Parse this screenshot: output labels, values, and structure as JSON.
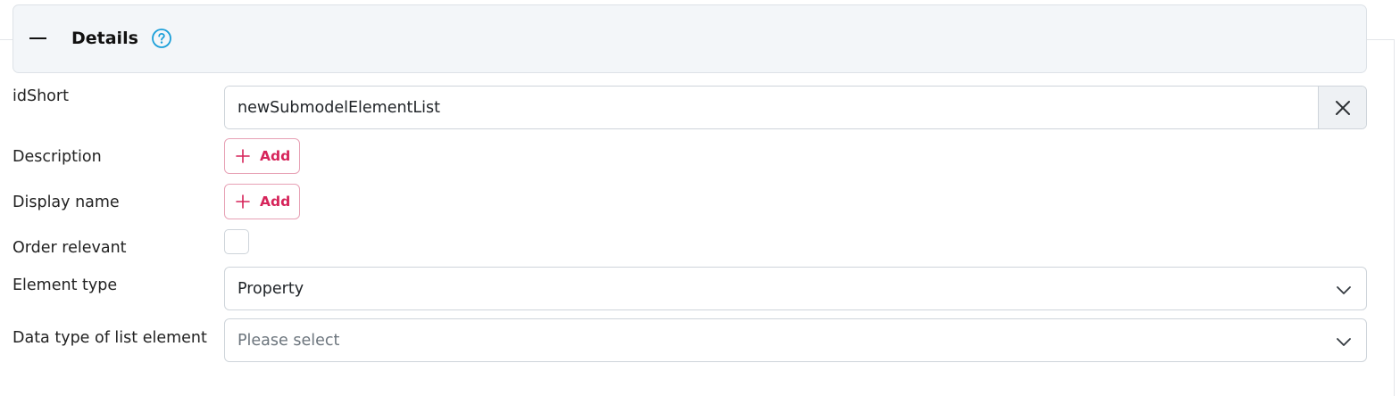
{
  "header": {
    "title": "Details",
    "collapse_icon": "minus-icon",
    "help_icon": "question-circle-icon",
    "accent_color": "#1a9fd9"
  },
  "fields": {
    "idShort": {
      "label": "idShort",
      "value": "newSubmodelElementList",
      "clear_icon": "close-icon"
    },
    "description": {
      "label": "Description",
      "button_label": "Add"
    },
    "display_name": {
      "label": "Display name",
      "button_label": "Add"
    },
    "order_relevant": {
      "label": "Order relevant",
      "checked": false
    },
    "element_type": {
      "label": "Element type",
      "selected": "Property"
    },
    "data_type": {
      "label": "Data type of list element",
      "placeholder": "Please select"
    }
  },
  "colors": {
    "add_button_text": "#d6245a",
    "add_button_border": "#e7a1b5",
    "header_background": "#f3f6f9"
  }
}
